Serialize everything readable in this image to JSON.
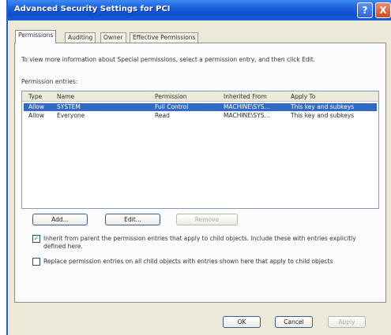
{
  "window": {
    "title": "Advanced Security Settings for PCI",
    "help_glyph": "?",
    "close_glyph": "X"
  },
  "tabs": [
    {
      "label": "Permissions",
      "active": true
    },
    {
      "label": "Auditing",
      "active": false
    },
    {
      "label": "Owner",
      "active": false
    },
    {
      "label": "Effective Permissions",
      "active": false
    }
  ],
  "info_text": "To view more information about Special permissions, select a permission entry, and then click Edit.",
  "entries_label": "Permission entries:",
  "table": {
    "columns": [
      "Type",
      "Name",
      "Permission",
      "Inherited From",
      "Apply To"
    ],
    "rows": [
      {
        "type": "Allow",
        "name": "SYSTEM",
        "permission": "Full Control",
        "inherited": "MACHINE\\SYS...",
        "apply": "This key and subkeys",
        "selected": true
      },
      {
        "type": "Allow",
        "name": "Everyone",
        "permission": "Read",
        "inherited": "MACHINE\\SYS...",
        "apply": "This key and subkeys",
        "selected": false
      }
    ]
  },
  "buttons": {
    "add": "Add...",
    "edit": "Edit...",
    "remove": "Remove"
  },
  "checkboxes": {
    "inherit": {
      "label": "Inherit from parent the permission entries that apply to child objects. Include these with entries explicitly defined here.",
      "checked": true
    },
    "replace": {
      "label": "Replace permission entries on all child objects with entries shown here that apply to child objects",
      "checked": false
    }
  },
  "dialog_buttons": {
    "ok": "OK",
    "cancel": "Cancel",
    "apply": "Apply"
  }
}
